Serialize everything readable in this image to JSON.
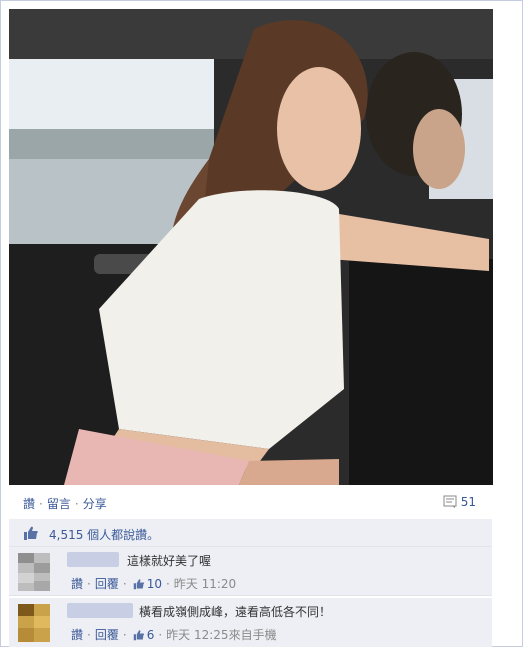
{
  "post": {
    "actions": {
      "like": "讚",
      "comment": "留言",
      "share": "分享",
      "separator": "·"
    },
    "comment_count": "51",
    "likes_text": "4,515 個人都說讚。"
  },
  "comments": [
    {
      "text": "這樣就好美了喔",
      "like_label": "讚",
      "reply_label": "回覆",
      "like_count": "10",
      "time": "昨天 11:20",
      "via": ""
    },
    {
      "text": "橫看成嶺側成峰，遠看高低各不同！",
      "like_label": "讚",
      "reply_label": "回覆",
      "like_count": "6",
      "time": "昨天 12:25",
      "via": "來自手機"
    }
  ],
  "colors": {
    "link": "#3b5998",
    "meta": "#8a8a8a",
    "panel": "#edeff4"
  }
}
